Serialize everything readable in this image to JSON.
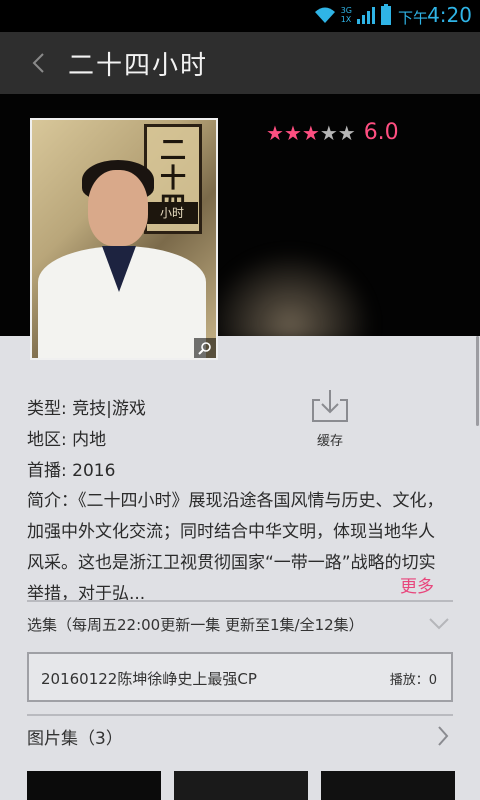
{
  "status_bar": {
    "net_top": "3G",
    "net_bottom": "1X",
    "ampm": "下午",
    "time": "4:20",
    "accent": "#2fb4e6"
  },
  "header": {
    "title": "二十四小时",
    "back_icon": "chevron-left-icon"
  },
  "poster": {
    "title_chars": [
      "二",
      "十",
      "四"
    ],
    "subtitle": "小时",
    "zoom_icon": "search-icon"
  },
  "rating": {
    "stars_filled": 3,
    "stars_total": 5,
    "score": "6.0",
    "color": "#ff4f81"
  },
  "details": {
    "type_label": "类型:",
    "type_value": "竞技|游戏",
    "region_label": "地区:",
    "region_value": "内地",
    "premiere_label": "首播:",
    "premiere_value": "2016"
  },
  "cache": {
    "icon": "download-icon",
    "label": "缓存"
  },
  "summary": {
    "label": "简介：",
    "text": "《二十四小时》展现沿途各国风情与历史、文化，加强中外文化交流；同时结合中华文明，体现当地华人风采。这也是浙江卫视贯彻国家“一带一路”战略的切实举措，对于弘...",
    "more": "更多"
  },
  "episodes": {
    "header": "选集（每周五22:00更新一集 更新至1集/全12集）",
    "items": [
      {
        "title": "20160122陈坤徐峥史上最强CP",
        "plays": "播放：0"
      }
    ]
  },
  "gallery": {
    "header": "图片集（3）"
  }
}
